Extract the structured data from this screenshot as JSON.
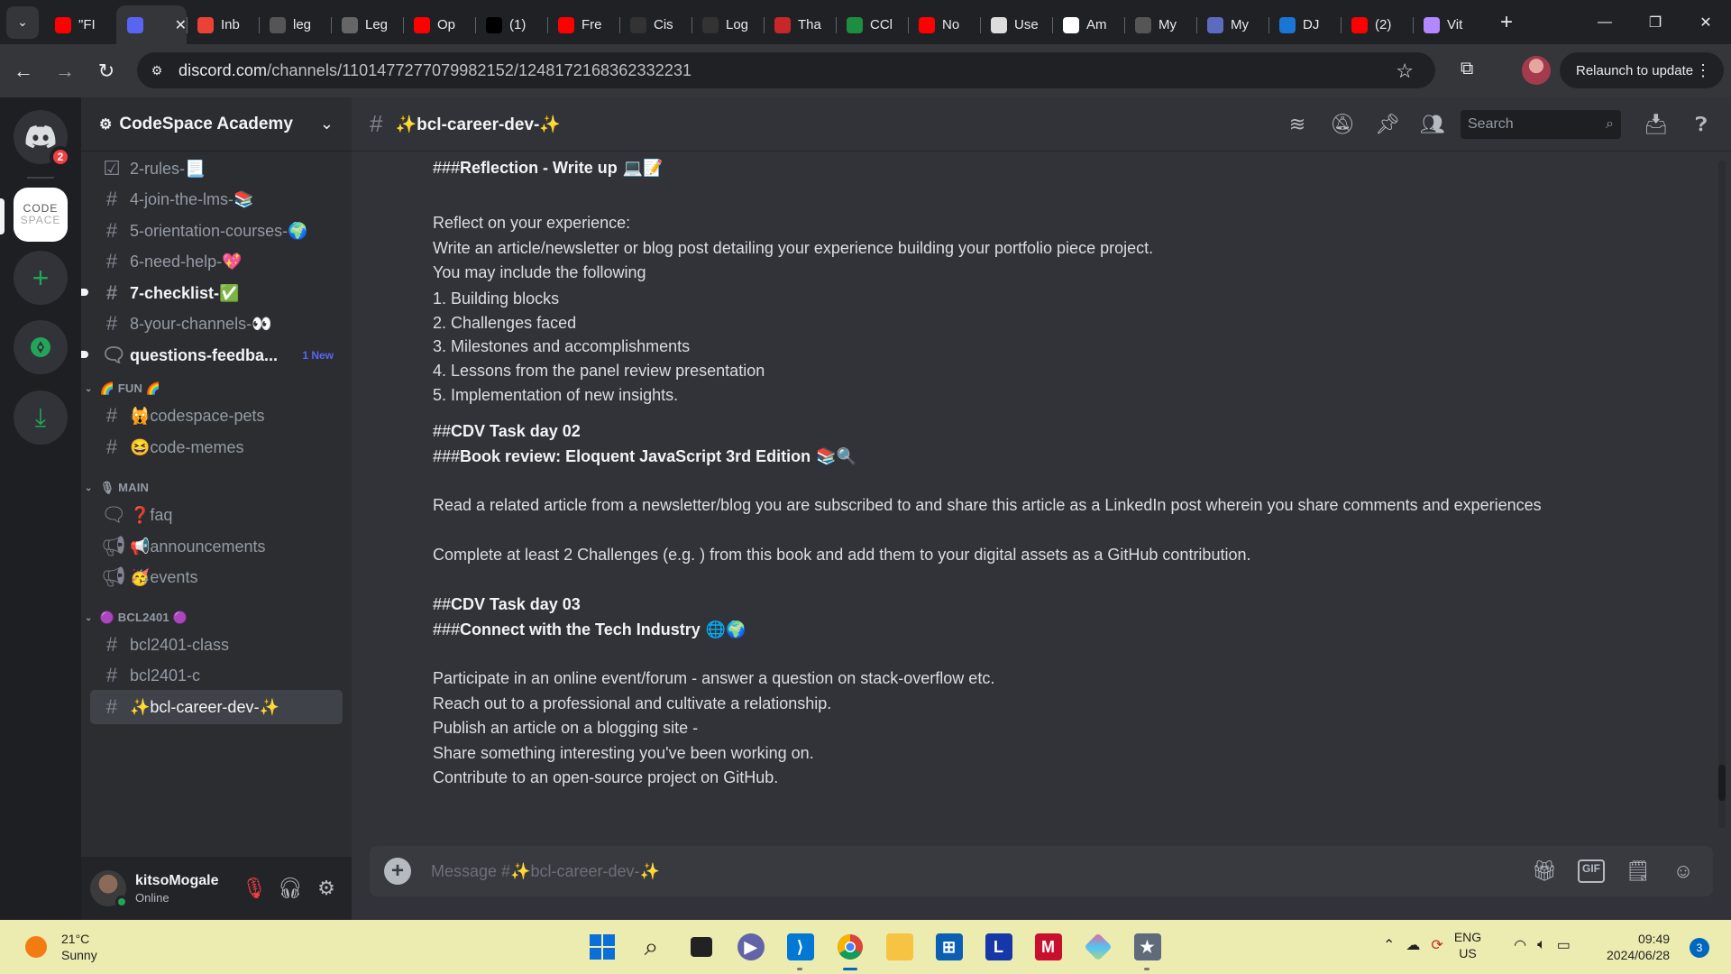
{
  "browser": {
    "tabs": [
      {
        "title": "\"FI",
        "icon": "youtube",
        "color": "#ff0000"
      },
      {
        "title": "",
        "icon": "discord",
        "color": "#5865f2",
        "active": true
      },
      {
        "title": "Inb",
        "icon": "gmail",
        "color": "#ea4335"
      },
      {
        "title": "leg",
        "icon": "github",
        "color": "#555"
      },
      {
        "title": "Leg",
        "icon": "globe",
        "color": "#666"
      },
      {
        "title": "Op",
        "icon": "youtube",
        "color": "#ff0000"
      },
      {
        "title": "(1)",
        "icon": "x",
        "color": "#000"
      },
      {
        "title": "Fre",
        "icon": "youtube",
        "color": "#ff0000"
      },
      {
        "title": "Cis",
        "icon": "cisco",
        "color": "#333"
      },
      {
        "title": "Log",
        "icon": "page",
        "color": "#333"
      },
      {
        "title": "Tha",
        "icon": "cloud",
        "color": "#c62828"
      },
      {
        "title": "CCl",
        "icon": "drive",
        "color": "#1e8e3e"
      },
      {
        "title": "No",
        "icon": "youtube",
        "color": "#ff0000"
      },
      {
        "title": "Use",
        "icon": "openai",
        "color": "#ddd"
      },
      {
        "title": "Am",
        "icon": "amazon",
        "color": "#fff"
      },
      {
        "title": "My",
        "icon": "github",
        "color": "#555"
      },
      {
        "title": "My",
        "icon": "app",
        "color": "#5c6bc0"
      },
      {
        "title": "DJ",
        "icon": "onedrive",
        "color": "#1976d2"
      },
      {
        "title": "(2)",
        "icon": "youtube",
        "color": "#ff0000"
      },
      {
        "title": "Vit",
        "icon": "vite",
        "color": "#b388ff"
      }
    ],
    "url_host": "discord.com",
    "url_path": "/channels/1101477277079982152/1248172168362332231",
    "relaunch": "Relaunch to update"
  },
  "rail": {
    "home_badge": "2",
    "codespace_line1": "CODE",
    "codespace_line2": "SPACE"
  },
  "server": {
    "name": "CodeSpace Academy"
  },
  "channels": [
    {
      "name": "2-rules-📃",
      "type": "rules"
    },
    {
      "name": "4-join-the-lms-📚",
      "type": "text"
    },
    {
      "name": "5-orientation-courses-🌍",
      "type": "text"
    },
    {
      "name": "6-need-help-💖",
      "type": "text"
    },
    {
      "name": "7-checklist-✅",
      "type": "text",
      "unread": true
    },
    {
      "name": "8-your-channels-👀",
      "type": "text"
    },
    {
      "name": "questions-feedba...",
      "type": "forum",
      "unread": true,
      "badge": "1 New"
    },
    {
      "category": "🌈 FUN 🌈"
    },
    {
      "name": "🙀codespace-pets",
      "type": "text"
    },
    {
      "name": "😆code-memes",
      "type": "text"
    },
    {
      "category": "🎙 MAIN"
    },
    {
      "name": "❓faq",
      "type": "forum"
    },
    {
      "name": "📢announcements",
      "type": "announce"
    },
    {
      "name": "🥳events",
      "type": "announce"
    },
    {
      "category": "🟣 BCL2401 🟣"
    },
    {
      "name": "bcl2401-class",
      "type": "thread"
    },
    {
      "name": "bcl2401-c",
      "type": "thread"
    },
    {
      "name": "✨bcl-career-dev-✨",
      "type": "thread",
      "active": true
    }
  ],
  "user": {
    "name": "kitsoMogale",
    "status": "Online"
  },
  "channel_header": {
    "name": "✨bcl-career-dev-✨",
    "search_placeholder": "Search"
  },
  "messages": {
    "lines": [
      {
        "prefix": "###",
        "bold": "Reflection - Write up",
        "emoji": "💻📝",
        "heading": true
      },
      {
        "text": ""
      },
      {
        "text": "Reflect on your experience:"
      },
      {
        "text": "Write an article/newsletter or blog post detailing your experience building your portfolio piece project."
      },
      {
        "text": "You may include the following"
      },
      {
        "text": "1. Building blocks"
      },
      {
        "text": "2. Challenges faced"
      },
      {
        "text": "3. Milestones and accomplishments"
      },
      {
        "text": "4. Lessons from the panel review presentation"
      },
      {
        "text": "5. Implementation of new insights."
      },
      {
        "prefix": "##",
        "bold": "CDV Task day 02",
        "heading": true
      },
      {
        "prefix": "###",
        "bold": "Book review: Eloquent JavaScript 3rd Edition",
        "emoji": "📚🔍",
        "heading": true
      },
      {
        "text": "Read a related article from a newsletter/blog you are subscribed to and share this article as a LinkedIn post wherein you share comments and experiences"
      },
      {
        "text": "Complete at least 2 Challenges (e.g. ) from this book and add them to your digital assets as a GitHub contribution."
      },
      {
        "prefix": "##",
        "bold": "CDV Task day 03",
        "heading": true
      },
      {
        "prefix": "###",
        "bold": "Connect with the Tech Industry",
        "emoji": "🌐🌍",
        "heading": true
      },
      {
        "text": "Participate in an online event/forum - answer a question on stack-overflow etc."
      },
      {
        "text": "Reach out to a professional and cultivate a relationship."
      },
      {
        "text": "Publish an article on a blogging site -"
      },
      {
        "text": "Share something interesting you've been working on."
      },
      {
        "text": "Contribute to an open-source project on GitHub."
      }
    ]
  },
  "composer": {
    "placeholder": "Message #✨bcl-career-dev-✨",
    "gif_label": "GIF"
  },
  "taskbar": {
    "temp": "21°C",
    "condition": "Sunny",
    "lang1": "ENG",
    "lang2": "US",
    "time": "09:49",
    "date": "2024/06/28",
    "notifications": "3"
  }
}
